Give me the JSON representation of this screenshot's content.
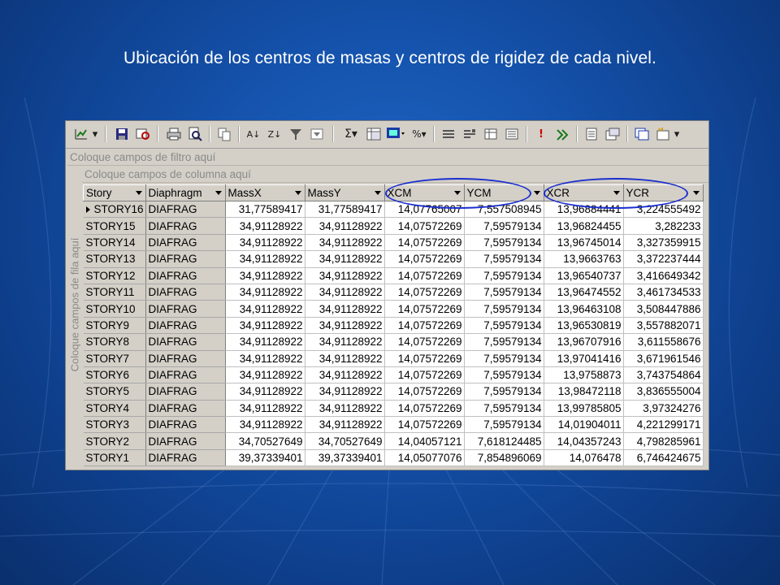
{
  "slide": {
    "title": "Ubicación de los centros de masas y centros de rigidez de cada nivel."
  },
  "grid": {
    "filter_zone_text": "Coloque campos de filtro aquí",
    "column_zone_text": "Coloque campos de columna aquí",
    "row_zone_text": "Coloque campos de fila aquí",
    "headers": [
      "Story",
      "Diaphragm",
      "MassX",
      "MassY",
      "XCM",
      "YCM",
      "XCR",
      "YCR"
    ],
    "rows": [
      [
        "STORY16",
        "DIAFRAG",
        "31,77589417",
        "31,77589417",
        "14,07765007",
        "7,557508945",
        "13,96884441",
        "3,224555492"
      ],
      [
        "STORY15",
        "DIAFRAG",
        "34,91128922",
        "34,91128922",
        "14,07572269",
        "7,59579134",
        "13,96824455",
        "3,282233"
      ],
      [
        "STORY14",
        "DIAFRAG",
        "34,91128922",
        "34,91128922",
        "14,07572269",
        "7,59579134",
        "13,96745014",
        "3,327359915"
      ],
      [
        "STORY13",
        "DIAFRAG",
        "34,91128922",
        "34,91128922",
        "14,07572269",
        "7,59579134",
        "13,9663763",
        "3,372237444"
      ],
      [
        "STORY12",
        "DIAFRAG",
        "34,91128922",
        "34,91128922",
        "14,07572269",
        "7,59579134",
        "13,96540737",
        "3,416649342"
      ],
      [
        "STORY11",
        "DIAFRAG",
        "34,91128922",
        "34,91128922",
        "14,07572269",
        "7,59579134",
        "13,96474552",
        "3,461734533"
      ],
      [
        "STORY10",
        "DIAFRAG",
        "34,91128922",
        "34,91128922",
        "14,07572269",
        "7,59579134",
        "13,96463108",
        "3,508447886"
      ],
      [
        "STORY9",
        "DIAFRAG",
        "34,91128922",
        "34,91128922",
        "14,07572269",
        "7,59579134",
        "13,96530819",
        "3,557882071"
      ],
      [
        "STORY8",
        "DIAFRAG",
        "34,91128922",
        "34,91128922",
        "14,07572269",
        "7,59579134",
        "13,96707916",
        "3,611558676"
      ],
      [
        "STORY7",
        "DIAFRAG",
        "34,91128922",
        "34,91128922",
        "14,07572269",
        "7,59579134",
        "13,97041416",
        "3,671961546"
      ],
      [
        "STORY6",
        "DIAFRAG",
        "34,91128922",
        "34,91128922",
        "14,07572269",
        "7,59579134",
        "13,9758873",
        "3,743754864"
      ],
      [
        "STORY5",
        "DIAFRAG",
        "34,91128922",
        "34,91128922",
        "14,07572269",
        "7,59579134",
        "13,98472118",
        "3,836555004"
      ],
      [
        "STORY4",
        "DIAFRAG",
        "34,91128922",
        "34,91128922",
        "14,07572269",
        "7,59579134",
        "13,99785805",
        "3,97324276"
      ],
      [
        "STORY3",
        "DIAFRAG",
        "34,91128922",
        "34,91128922",
        "14,07572269",
        "7,59579134",
        "14,01904011",
        "4,221299171"
      ],
      [
        "STORY2",
        "DIAFRAG",
        "34,70527649",
        "34,70527649",
        "14,04057121",
        "7,618124485",
        "14,04357243",
        "4,798285961"
      ],
      [
        "STORY1",
        "DIAFRAG",
        "39,37339401",
        "39,37339401",
        "14,05077076",
        "7,854896069",
        "14,076478",
        "6,746424675"
      ]
    ]
  },
  "toolbar_icons": [
    "chart-wizard-icon",
    "dropdown-arrow-icon",
    "save-icon",
    "open-query-icon",
    "print-icon",
    "print-preview-icon",
    "copy-icon",
    "sort-ascending-icon",
    "sort-descending-icon",
    "filter-icon",
    "autofilter-icon",
    "sum-icon",
    "pivot-icon",
    "chart-icon",
    "percent-icon",
    "collapse-icon",
    "expand-icon",
    "show-top-icon",
    "field-list-icon",
    "alert-icon",
    "refresh-icon",
    "properties-icon",
    "commands-icon",
    "export-icon",
    "new-field-icon",
    "dropdown-arrow-icon"
  ],
  "colors": {
    "background": "#1553ad",
    "highlight_ellipse": "#1a2ecf",
    "grid_face": "#d4d0c8"
  }
}
